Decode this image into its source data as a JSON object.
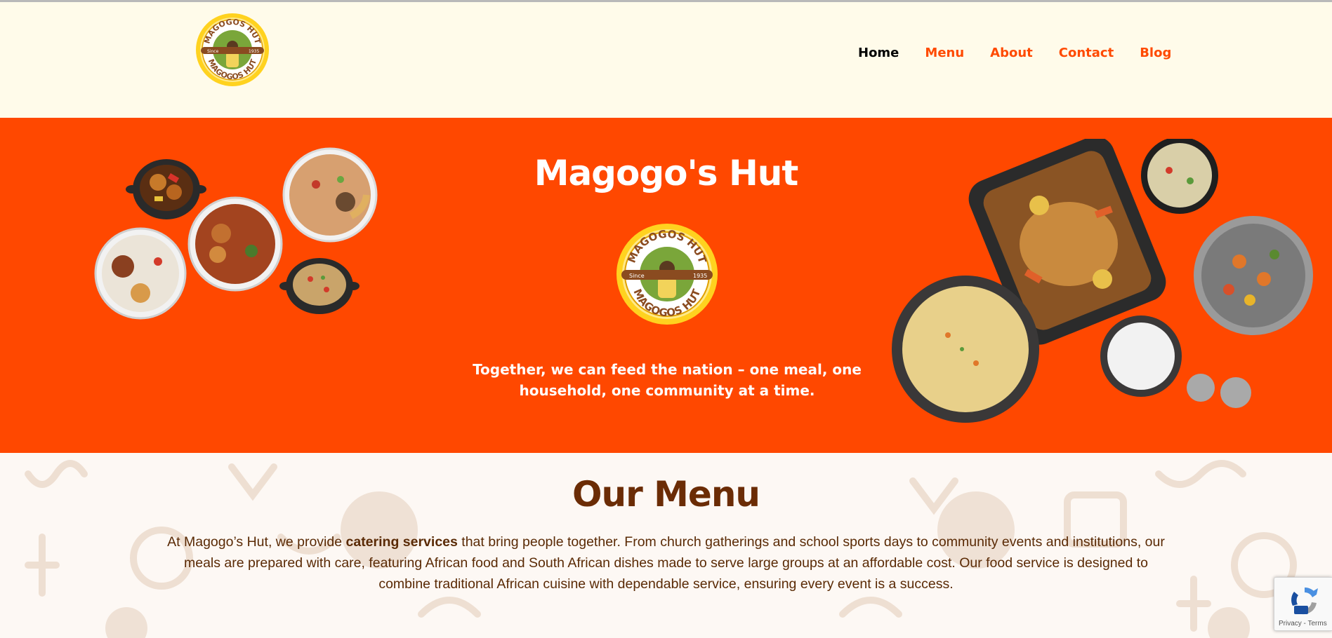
{
  "header": {
    "logo": {
      "top_text": "MAGOGOS HUT",
      "bottom_text": "MAGOGOS HUT",
      "left_badge": "Since",
      "right_badge": "1935"
    },
    "nav": [
      {
        "label": "Home",
        "active": true
      },
      {
        "label": "Menu",
        "active": false
      },
      {
        "label": "About",
        "active": false
      },
      {
        "label": "Contact",
        "active": false
      },
      {
        "label": "Blog",
        "active": false
      }
    ]
  },
  "hero": {
    "title": "Magogo's Hut",
    "tagline": "Together, we can feed the nation – one meal, one household, one community at a time.",
    "background_color": "#ff4800"
  },
  "menu_section": {
    "title": "Our Menu",
    "text_before": "At Magogo’s Hut, we provide ",
    "text_bold": "catering services",
    "text_after": " that bring people together. From church gatherings and school sports days to community events and institutions, our meals are prepared with care, featuring African food and South African dishes made to serve large groups at an affordable cost. Our food service is designed to combine traditional African cuisine with dependable service, ensuring every event is a success."
  },
  "recaptcha": {
    "links": "Privacy - Terms"
  },
  "colors": {
    "accent": "#ff4a00",
    "brown": "#6b2c05",
    "cream": "#fffbea"
  }
}
